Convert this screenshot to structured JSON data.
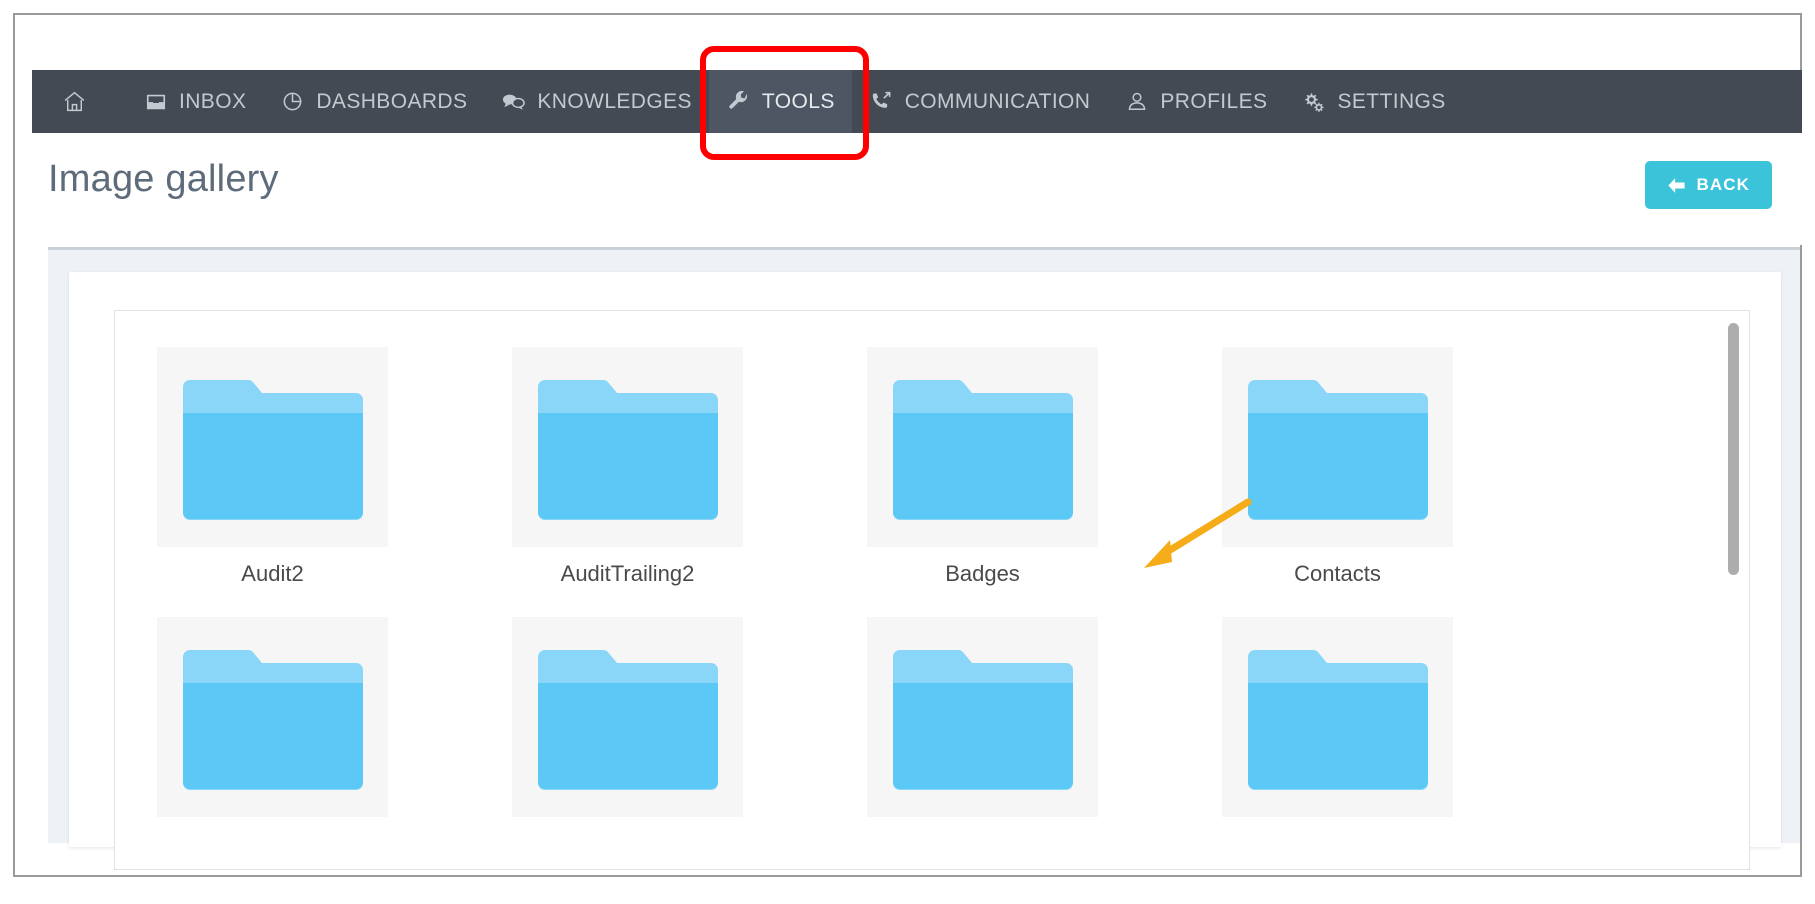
{
  "nav": {
    "items": [
      {
        "label": "",
        "icon": "home-icon",
        "name": "home",
        "active": false
      },
      {
        "label": "INBOX",
        "icon": "inbox-icon",
        "name": "inbox",
        "active": false
      },
      {
        "label": "DASHBOARDS",
        "icon": "pie-chart-icon",
        "name": "dashboards",
        "active": false
      },
      {
        "label": "KNOWLEDGES",
        "icon": "speech-bubbles-icon",
        "name": "knowledges",
        "active": false
      },
      {
        "label": "TOOLS",
        "icon": "wrench-icon",
        "name": "tools",
        "active": true
      },
      {
        "label": "COMMUNICATION",
        "icon": "phone-outgoing-icon",
        "name": "communication",
        "active": false
      },
      {
        "label": "PROFILES",
        "icon": "user-icon",
        "name": "profiles",
        "active": false
      },
      {
        "label": "SETTINGS",
        "icon": "gears-icon",
        "name": "settings",
        "active": false
      }
    ]
  },
  "header": {
    "title": "Image gallery",
    "back_label": "BACK",
    "back_icon": "arrow-left-icon"
  },
  "gallery": {
    "folders": [
      {
        "label": "Audit2",
        "icon": "folder-icon"
      },
      {
        "label": "AuditTrailing2",
        "icon": "folder-icon"
      },
      {
        "label": "Badges",
        "icon": "folder-icon"
      },
      {
        "label": "Contacts",
        "icon": "folder-icon"
      },
      {
        "label": "",
        "icon": "folder-icon"
      },
      {
        "label": "",
        "icon": "folder-icon"
      },
      {
        "label": "",
        "icon": "folder-icon"
      },
      {
        "label": "",
        "icon": "folder-icon"
      }
    ]
  },
  "annotations": {
    "highlight_color": "#ff0000",
    "arrow_color": "#f5ac18",
    "highlight_target": "TOOLS",
    "arrow_target": "Badges"
  },
  "colors": {
    "navbar_bg": "#434a54",
    "navbar_active_bg": "#4e5663",
    "accent": "#3ac3d9",
    "folder_blue": "#5cc8f5",
    "folder_tab": "#8ad6f8",
    "title_text": "#5d6b7a"
  }
}
